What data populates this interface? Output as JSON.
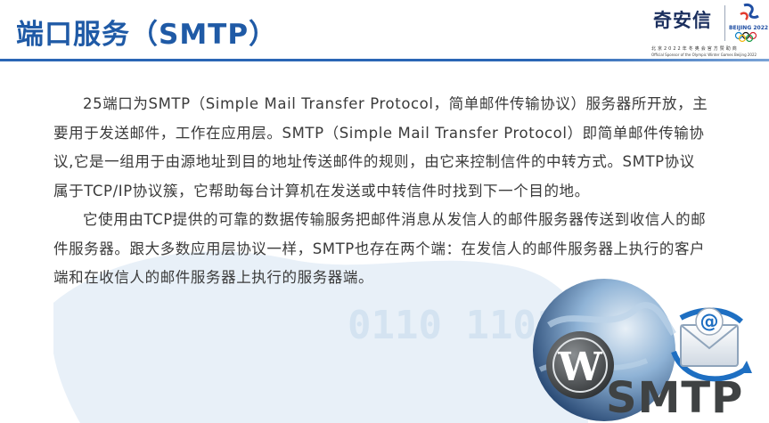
{
  "slide": {
    "title": "端口服务（SMTP）",
    "paragraphs": [
      "25端口为SMTP（Simple Mail Transfer Protocol，简单邮件传输协议）服务器所开放，主要用于发送邮件，工作在应用层。SMTP（Simple Mail Transfer Protocol）即简单邮件传输协议,它是一组用于由源地址到目的地址传送邮件的规则，由它来控制信件的中转方式。SMTP协议属于TCP/IP协议簇，它帮助每台计算机在发送或中转信件时找到下一个目的地。",
      "它使用由TCP提供的可靠的数据传输服务把邮件消息从发信人的邮件服务器传送到收信人的邮件服务器。跟大多数应用层协议一样，SMTP也存在两个端：在发信人的邮件服务器上执行的客户端和在收信人的邮件服务器上执行的服务器端。"
    ]
  },
  "brand": {
    "name": "奇安信",
    "emblem_text": "BEIJING 2022",
    "sponsor_cn": "北京2022年冬奥会官方赞助商",
    "sponsor_en": "Official Sponsor of the Olympic Winter Games Beijing 2022"
  },
  "illustration": {
    "label": "SMTP",
    "icons": [
      "globe-icon",
      "wordpress-icon",
      "email-envelope-icon"
    ]
  },
  "background": {
    "digits": "0110 1101"
  },
  "colors": {
    "title": "#1f5aa6",
    "rule": "#2a66b5",
    "body_text": "#3a3a3a",
    "label": "#3f4243",
    "watermark": "#dbe7f3"
  }
}
